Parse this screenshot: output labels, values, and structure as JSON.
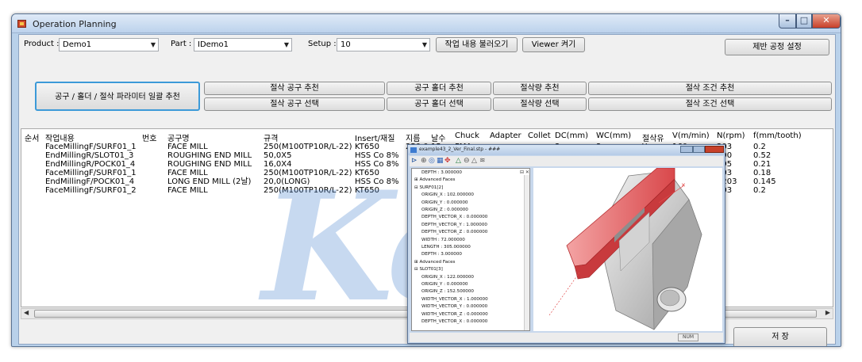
{
  "window": {
    "title": "Operation Planning",
    "min": "–",
    "max": "□",
    "close": "✕"
  },
  "controls": {
    "product_label": "Product :",
    "product_value": "Demo1",
    "part_label": "Part :",
    "part_value": "IDemo1",
    "setup_label": "Setup :",
    "setup_value": "10",
    "load_button": "작업 내용 불러오기",
    "viewer_button": "Viewer 켜기",
    "equipment_button": "제반 공정 설정"
  },
  "buttons": {
    "batch_recommend": "공구 / 홀더 / 절삭 파라미터 일괄 추천",
    "tool_recommend": "절삭 공구 추천",
    "tool_select": "절삭 공구 선택",
    "holder_recommend": "공구 홀더 추천",
    "holder_select": "공구 홀더 선택",
    "amount_recommend": "절삭량 추천",
    "amount_select": "절삭량 선택",
    "condition_recommend": "절삭 조건 추천",
    "condition_select": "절삭 조건 선택",
    "save": "저    장"
  },
  "table": {
    "columns": [
      "순서",
      "작업내용",
      "번호",
      "공구명",
      "규격",
      "Insert/재질",
      "지름",
      "날수",
      "Chuck",
      "Adapter",
      "Collet",
      "DC(mm)",
      "WC(mm)",
      "절삭유",
      "V(m/min)",
      "N(rpm)",
      "f(mm/tooth)"
    ],
    "rows": [
      {
        "task": "FaceMillingF/SURF01_1",
        "tool": "FACE MILL",
        "spec": "250(M100TP10R/L-22)",
        "insert": "KT650",
        "dia": "250.0",
        "teeth": "15",
        "chuck": "FMA",
        "adapter": "",
        "collet": "",
        "dc": "3",
        "wc": "3",
        "coolant": "Y",
        "v": "160",
        "n": "203",
        "f": "0.2"
      },
      {
        "task": "EndMillingR/SLOT01_3",
        "tool": "ROUGHING END MILL",
        "spec": "50,0X5",
        "insert": "HSS Co 8%",
        "dia": "",
        "teeth": "",
        "chuck": "",
        "adapter": "",
        "collet": "",
        "dc": "",
        "wc": "",
        "coolant": "",
        "v": "",
        "n": "190",
        "f": "0.52"
      },
      {
        "task": "EndMillingR/POCK01_4",
        "tool": "ROUGHING END MILL",
        "spec": "16,0X4",
        "insert": "HSS Co 8%",
        "dia": "",
        "teeth": "",
        "chuck": "",
        "adapter": "",
        "collet": "",
        "dc": "",
        "wc": "",
        "coolant": "",
        "v": "",
        "n": "695",
        "f": "0.21"
      },
      {
        "task": "FaceMillingF/SURF01_1",
        "tool": "FACE MILL",
        "spec": "250(M100TP10R/L-22)",
        "insert": "KT650",
        "dia": "",
        "teeth": "",
        "chuck": "",
        "adapter": "",
        "collet": "",
        "dc": "",
        "wc": "",
        "coolant": "",
        "v": "",
        "n": "203",
        "f": "0.18"
      },
      {
        "task": "EndMillingF/POCK01_4",
        "tool": "LONG END MILL (2날)",
        "spec": "20,0(LONG)",
        "insert": "HSS Co 8%",
        "dia": "",
        "teeth": "",
        "chuck": "",
        "adapter": "",
        "collet": "",
        "dc": "",
        "wc": "",
        "coolant": "",
        "v": "",
        "n": "1203",
        "f": "0.145"
      },
      {
        "task": "FaceMillingF/SURF01_2",
        "tool": "FACE MILL",
        "spec": "250(M100TP10R/L-22)",
        "insert": "KT650",
        "dia": "",
        "teeth": "",
        "chuck": "",
        "adapter": "",
        "collet": "",
        "dc": "",
        "wc": "",
        "coolant": "",
        "v": "",
        "n": "203",
        "f": "0.2"
      }
    ]
  },
  "viewer": {
    "title": "example43_2_Ver_Final.stp - ###",
    "status": "NUM",
    "tree": [
      "DEPTH : 3.000000",
      "⊞ Advanced Faces",
      "⊟ SURF01[2]",
      "ORIGIN_X : 102.000000",
      "ORIGIN_Y : 0.000000",
      "ORIGIN_Z : 0.000000",
      "DEPTH_VECTOR_X : 0.000000",
      "DEPTH_VECTOR_Y : 1.000000",
      "DEPTH_VECTOR_Z : 0.000000",
      "WIDTH : 72.000000",
      "LENGTH : 305.000000",
      "DEPTH : 3.000000",
      "⊞ Advanced Faces",
      "⊟ SLOT01[3]",
      "ORIGIN_X : 122.000000",
      "ORIGIN_Y : 0.000000",
      "ORIGIN_Z : 152.500000",
      "WIDTH_VECTOR_X : 1.000000",
      "WIDTH_VECTOR_Y : 0.000000",
      "WIDTH_VECTOR_Z : 0.000000",
      "DEPTH_VECTOR_X : 0.000000"
    ]
  },
  "watermark": "Keit",
  "colors": {
    "window_frame": "#b9d1ea",
    "client": "#f0f0f0",
    "highlight_border": "#3c9ad8",
    "part_red": "#e8787a"
  }
}
